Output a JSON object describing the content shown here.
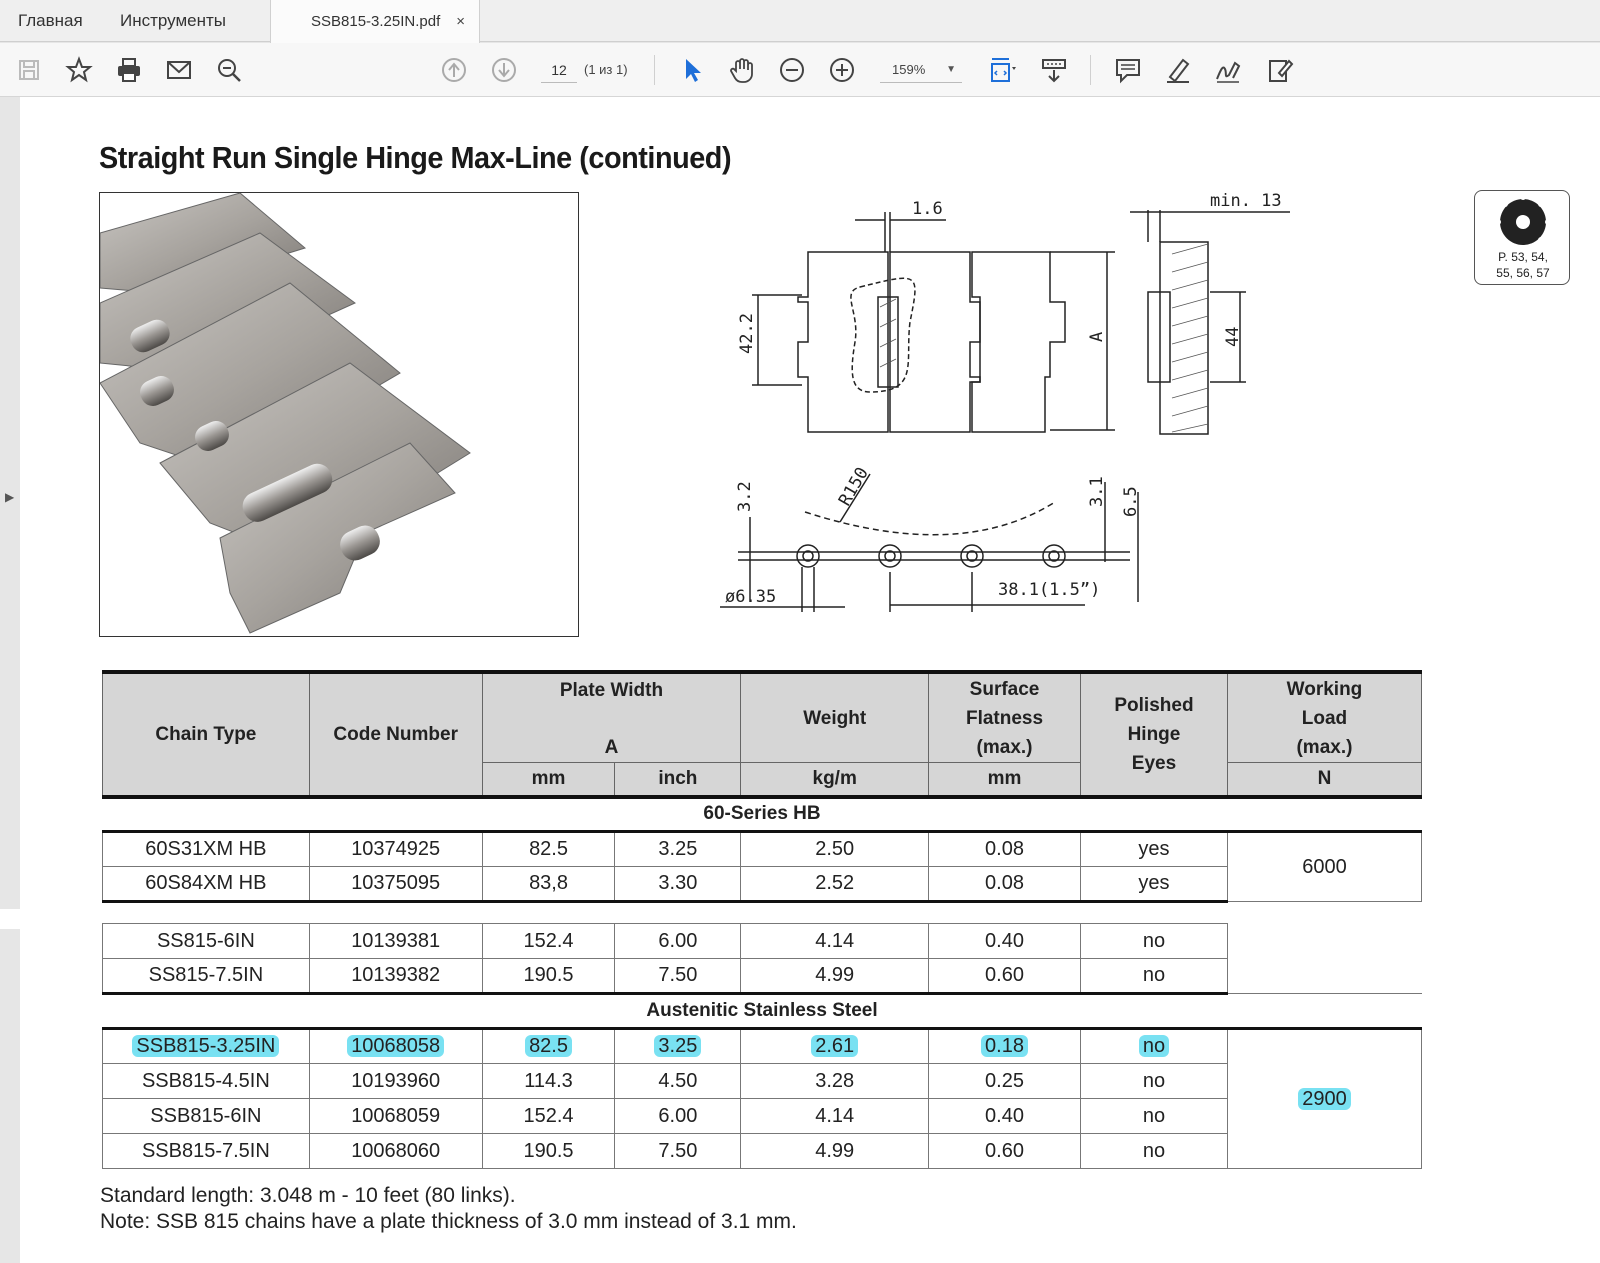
{
  "tabs": {
    "home": "Главная",
    "tools": "Инструменты",
    "document": "SSB815-3.25IN.pdf",
    "close": "×"
  },
  "toolbar": {
    "page_number": "12",
    "page_of": "(1 из 1)",
    "zoom": "159%",
    "zoom_caret": "▼"
  },
  "icons": [
    "save-icon",
    "bookmark-star-icon",
    "print-icon",
    "mail-icon",
    "zoom-search-icon",
    "page-up-icon",
    "page-down-icon",
    "select-cursor-icon",
    "hand-icon",
    "zoom-out-icon",
    "zoom-in-icon",
    "fit-page-icon",
    "scroll-mode-icon",
    "comment-icon",
    "highlight-pen-icon",
    "sign-icon",
    "fill-sign-icon"
  ],
  "document": {
    "title": "Straight Run Single Hinge Max-Line (continued)",
    "badge": {
      "line1": "P. 53, 54,",
      "line2": "55, 56, 57"
    },
    "drawing": {
      "dim_1_6": "1.6",
      "dim_min13": "min. 13",
      "dim_42_2": "42.2",
      "dim_A": "A",
      "dim_44": "44",
      "dim_R150": "R150",
      "dim_3_2": "3.2",
      "dim_3_1": "3.1",
      "dim_6_5": "6.5",
      "dim_d635": "ø6.35",
      "dim_pitch": "38.1(1.5”)"
    },
    "table": {
      "headers": {
        "chain_type": "Chain Type",
        "code_number": "Code Number",
        "plate_width": "Plate Width",
        "plate_width_sub": "A",
        "weight": "Weight",
        "surface_flatness": "Surface Flatness (max.)",
        "polished": "Polished Hinge Eyes",
        "working_load": "Working Load (max.)",
        "u_mm": "mm",
        "u_inch": "inch",
        "u_kgm": "kg/m",
        "u_mm2": "mm",
        "u_n": "N"
      },
      "section_60": "60-Series HB",
      "rows_60": [
        {
          "type": "60S31XM HB",
          "code": "10374925",
          "mm": "82.5",
          "inch": "3.25",
          "kgm": "2.50",
          "flat": "0.08",
          "pol": "yes"
        },
        {
          "type": "60S84XM HB",
          "code": "10375095",
          "mm": "83,8",
          "inch": "3.30",
          "kgm": "2.52",
          "flat": "0.08",
          "pol": "yes"
        }
      ],
      "load_60": "6000",
      "rows_ss": [
        {
          "type": "SS815-6IN",
          "code": "10139381",
          "mm": "152.4",
          "inch": "6.00",
          "kgm": "4.14",
          "flat": "0.40",
          "pol": "no"
        },
        {
          "type": "SS815-7.5IN",
          "code": "10139382",
          "mm": "190.5",
          "inch": "7.50",
          "kgm": "4.99",
          "flat": "0.60",
          "pol": "no"
        }
      ],
      "section_aus": "Austenitic Stainless Steel",
      "rows_aus": [
        {
          "type": "SSB815-3.25IN",
          "code": "10068058",
          "mm": "82.5",
          "inch": "3.25",
          "kgm": "2.61",
          "flat": "0.18",
          "pol": "no"
        },
        {
          "type": "SSB815-4.5IN",
          "code": "10193960",
          "mm": "114.3",
          "inch": "4.50",
          "kgm": "3.28",
          "flat": "0.25",
          "pol": "no"
        },
        {
          "type": "SSB815-6IN",
          "code": "10068059",
          "mm": "152.4",
          "inch": "6.00",
          "kgm": "4.14",
          "flat": "0.40",
          "pol": "no"
        },
        {
          "type": "SSB815-7.5IN",
          "code": "10068060",
          "mm": "190.5",
          "inch": "7.50",
          "kgm": "4.99",
          "flat": "0.60",
          "pol": "no"
        }
      ],
      "load_aus": "2900"
    },
    "note1": "Standard length: 3.048 m - 10 feet (80 links).",
    "note2": "Note: SSB 815 chains have a plate thickness of 3.0 mm instead of 3.1 mm."
  }
}
